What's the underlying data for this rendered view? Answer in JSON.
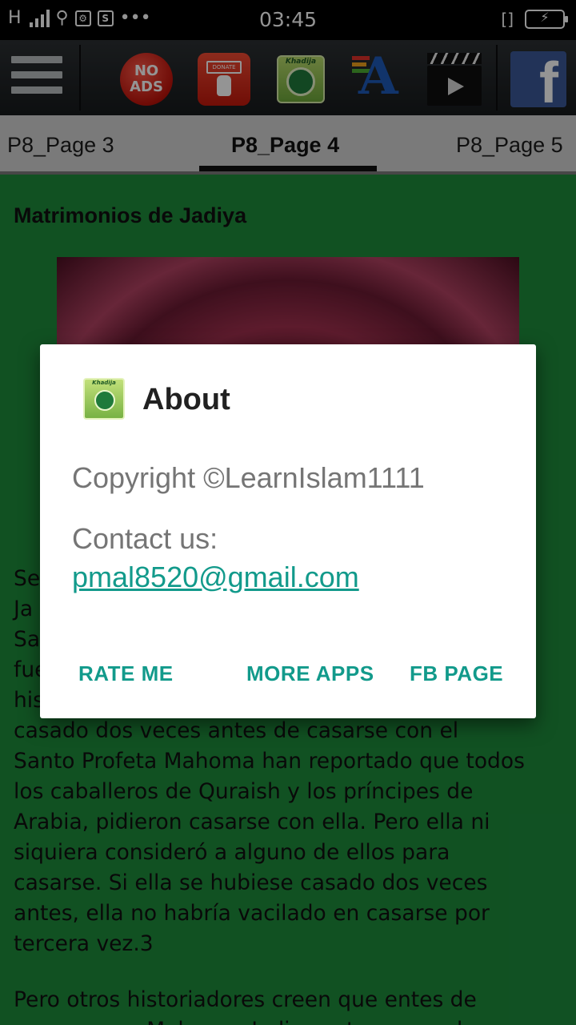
{
  "status_bar": {
    "network": "H",
    "sim_badge": "S",
    "dots": "•••",
    "time": "03:45",
    "vibrate_glyph": "[]",
    "battery_glyph": "⚡"
  },
  "toolbar": {
    "no_ads_line1": "NO",
    "no_ads_line2": "ADS",
    "donate_label": "DONATE",
    "khadija_label": "Khadija",
    "font_letter": "A",
    "facebook_letter": "f"
  },
  "tabs": [
    {
      "label": "P8_Page 3"
    },
    {
      "label": "P8_Page 4"
    },
    {
      "label": "P8_Page 5"
    }
  ],
  "content": {
    "title": "Matrimonios de Jadiya",
    "paragraph1_lines": [
      "Se",
      "Ja",
      "Sa",
      "fue",
      "his",
      "casado dos veces antes de casarse con el",
      "Santo Profeta Mahoma han reportado que todos",
      "los caballeros de Quraish y los príncipes de",
      "Arabia, pidieron casarse con ella. Pero ella ni",
      "siquiera consideró a alguno de ellos para",
      "casarse. Si ella se hubiese casado dos veces",
      "antes, ella no habría vacilado en casarse por",
      "tercera vez.3"
    ],
    "paragraph2_lines": [
      "Pero otros historiadores creen que entes de",
      "casarse con Mahoma, Jadiya estuvo casada"
    ]
  },
  "dialog": {
    "icon_label": "Khadija",
    "title": "About",
    "copyright": "Copyright ©LearnIslam1111",
    "contact_label": "Contact us:",
    "email": "pmal8520@gmail.com",
    "buttons": {
      "rate": "RATE ME",
      "more": "MORE APPS",
      "fb": "FB PAGE"
    }
  },
  "colors": {
    "content_bg": "#1e8c3c",
    "accent": "#129a8b",
    "toolbar_bg": "#212528",
    "tabs_bg": "#d3d3d3"
  }
}
